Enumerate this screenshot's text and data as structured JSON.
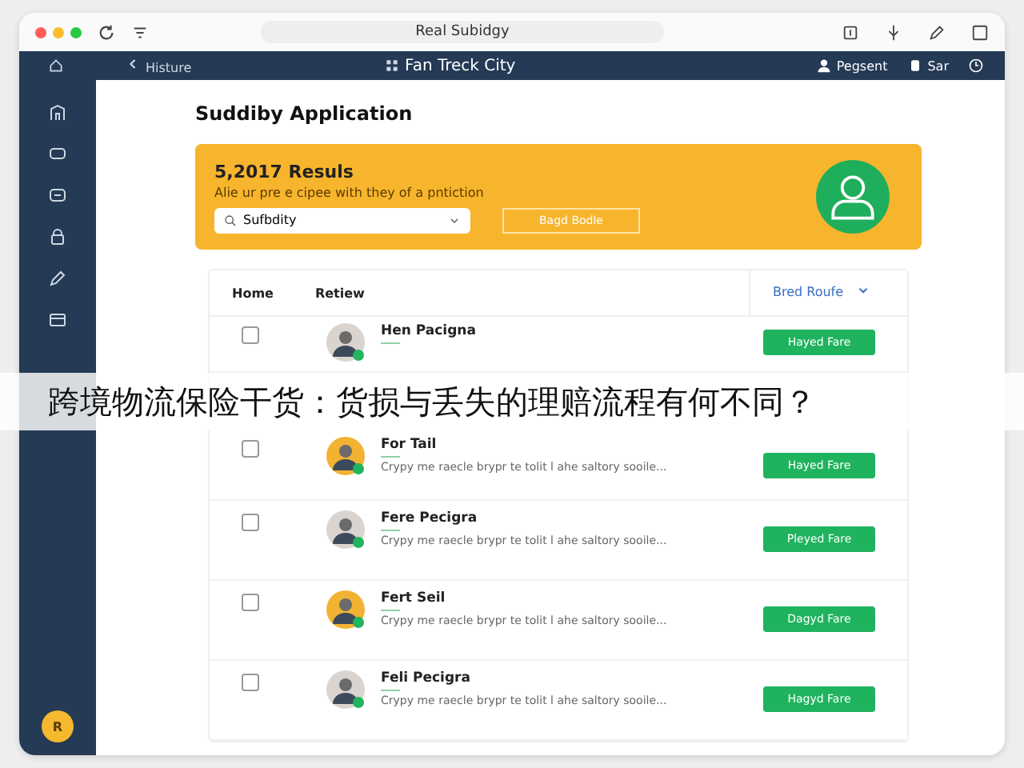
{
  "window": {
    "address": "Real Subidgy"
  },
  "nav": {
    "back": "Histure",
    "title": "Fan Treck City",
    "user": "Pegsent",
    "settings": "Sar"
  },
  "page_title": "Suddiby Application",
  "banner": {
    "heading": "5,2017 Resuls",
    "text": "Alie ur pre e cipee with they of a pntiction",
    "search": {
      "value": "Sufbdity"
    },
    "button": "Bagd Bodle"
  },
  "table": {
    "tabs": [
      {
        "label": "Home",
        "selected": false
      },
      {
        "label": "Retiew",
        "selected": false
      }
    ],
    "filter": "Bred Roufe",
    "rows": [
      {
        "name": "Hen Pacigna",
        "description": "",
        "button": "Hayed Fare",
        "checked": false,
        "color": "#d9d4cf"
      },
      {
        "name": "For Tail",
        "description": "Crypy me raecle brypr te tolit l ahe saltory sooile...",
        "button": "Hayed Fare",
        "checked": false,
        "color": "#f2b233"
      },
      {
        "name": "Fere Pecigra",
        "description": "Crypy me raecle brypr te tolit l ahe saltory sooile...",
        "button": "Pleyed Fare",
        "checked": false,
        "color": "#d9d4cf"
      },
      {
        "name": "Fert Seil",
        "description": "Crypy me raecle brypr te tolit l ahe saltory sooile...",
        "button": "Dagyd Fare",
        "checked": false,
        "color": "#f2b233"
      },
      {
        "name": "Feli Pecigra",
        "description": "Crypy me raecle brypr te tolit l ahe saltory sooile...",
        "button": "Hagyd Fare",
        "checked": false,
        "color": "#d9d4cf"
      }
    ]
  },
  "user_badge": "R",
  "caption": "跨境物流保险干货：货损与丢失的理赔流程有何不同？"
}
